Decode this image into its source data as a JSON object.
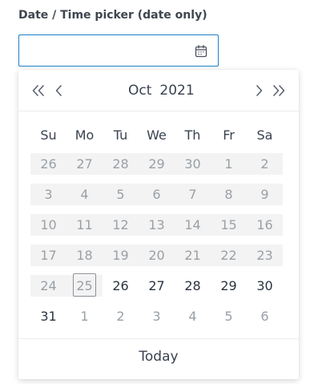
{
  "field": {
    "label": "Date / Time picker (date only)",
    "value": "",
    "placeholder": ""
  },
  "icons": {
    "calendar": "calendar-icon",
    "prev_year": "double-chevron-left-icon",
    "prev_month": "chevron-left-icon",
    "next_month": "chevron-right-icon",
    "next_year": "double-chevron-right-icon"
  },
  "colors": {
    "input_border": "#1f7fc6",
    "disabled_bg": "#f3f3f3",
    "muted_text": "#9aa0a6",
    "text": "#2b3440"
  },
  "calendar": {
    "month": "Oct",
    "year": "2021",
    "weekdays": [
      "Su",
      "Mo",
      "Tu",
      "We",
      "Th",
      "Fr",
      "Sa"
    ],
    "weeks": [
      [
        {
          "d": "26",
          "state": "disabled"
        },
        {
          "d": "27",
          "state": "disabled"
        },
        {
          "d": "28",
          "state": "disabled"
        },
        {
          "d": "29",
          "state": "disabled"
        },
        {
          "d": "30",
          "state": "disabled"
        },
        {
          "d": "1",
          "state": "disabled"
        },
        {
          "d": "2",
          "state": "disabled"
        }
      ],
      [
        {
          "d": "3",
          "state": "disabled"
        },
        {
          "d": "4",
          "state": "disabled"
        },
        {
          "d": "5",
          "state": "disabled"
        },
        {
          "d": "6",
          "state": "disabled"
        },
        {
          "d": "7",
          "state": "disabled"
        },
        {
          "d": "8",
          "state": "disabled"
        },
        {
          "d": "9",
          "state": "disabled"
        }
      ],
      [
        {
          "d": "10",
          "state": "disabled"
        },
        {
          "d": "11",
          "state": "disabled"
        },
        {
          "d": "12",
          "state": "disabled"
        },
        {
          "d": "13",
          "state": "disabled"
        },
        {
          "d": "14",
          "state": "disabled"
        },
        {
          "d": "15",
          "state": "disabled"
        },
        {
          "d": "16",
          "state": "disabled"
        }
      ],
      [
        {
          "d": "17",
          "state": "disabled"
        },
        {
          "d": "18",
          "state": "disabled"
        },
        {
          "d": "19",
          "state": "disabled"
        },
        {
          "d": "20",
          "state": "disabled"
        },
        {
          "d": "21",
          "state": "disabled"
        },
        {
          "d": "22",
          "state": "disabled"
        },
        {
          "d": "23",
          "state": "disabled"
        }
      ],
      [
        {
          "d": "24",
          "state": "disabled"
        },
        {
          "d": "25",
          "state": "today"
        },
        {
          "d": "26",
          "state": "active"
        },
        {
          "d": "27",
          "state": "active"
        },
        {
          "d": "28",
          "state": "active"
        },
        {
          "d": "29",
          "state": "active"
        },
        {
          "d": "30",
          "state": "active"
        }
      ],
      [
        {
          "d": "31",
          "state": "active"
        },
        {
          "d": "1",
          "state": "outside"
        },
        {
          "d": "2",
          "state": "outside"
        },
        {
          "d": "3",
          "state": "outside"
        },
        {
          "d": "4",
          "state": "outside"
        },
        {
          "d": "5",
          "state": "outside"
        },
        {
          "d": "6",
          "state": "outside"
        }
      ]
    ],
    "today_label": "Today"
  }
}
